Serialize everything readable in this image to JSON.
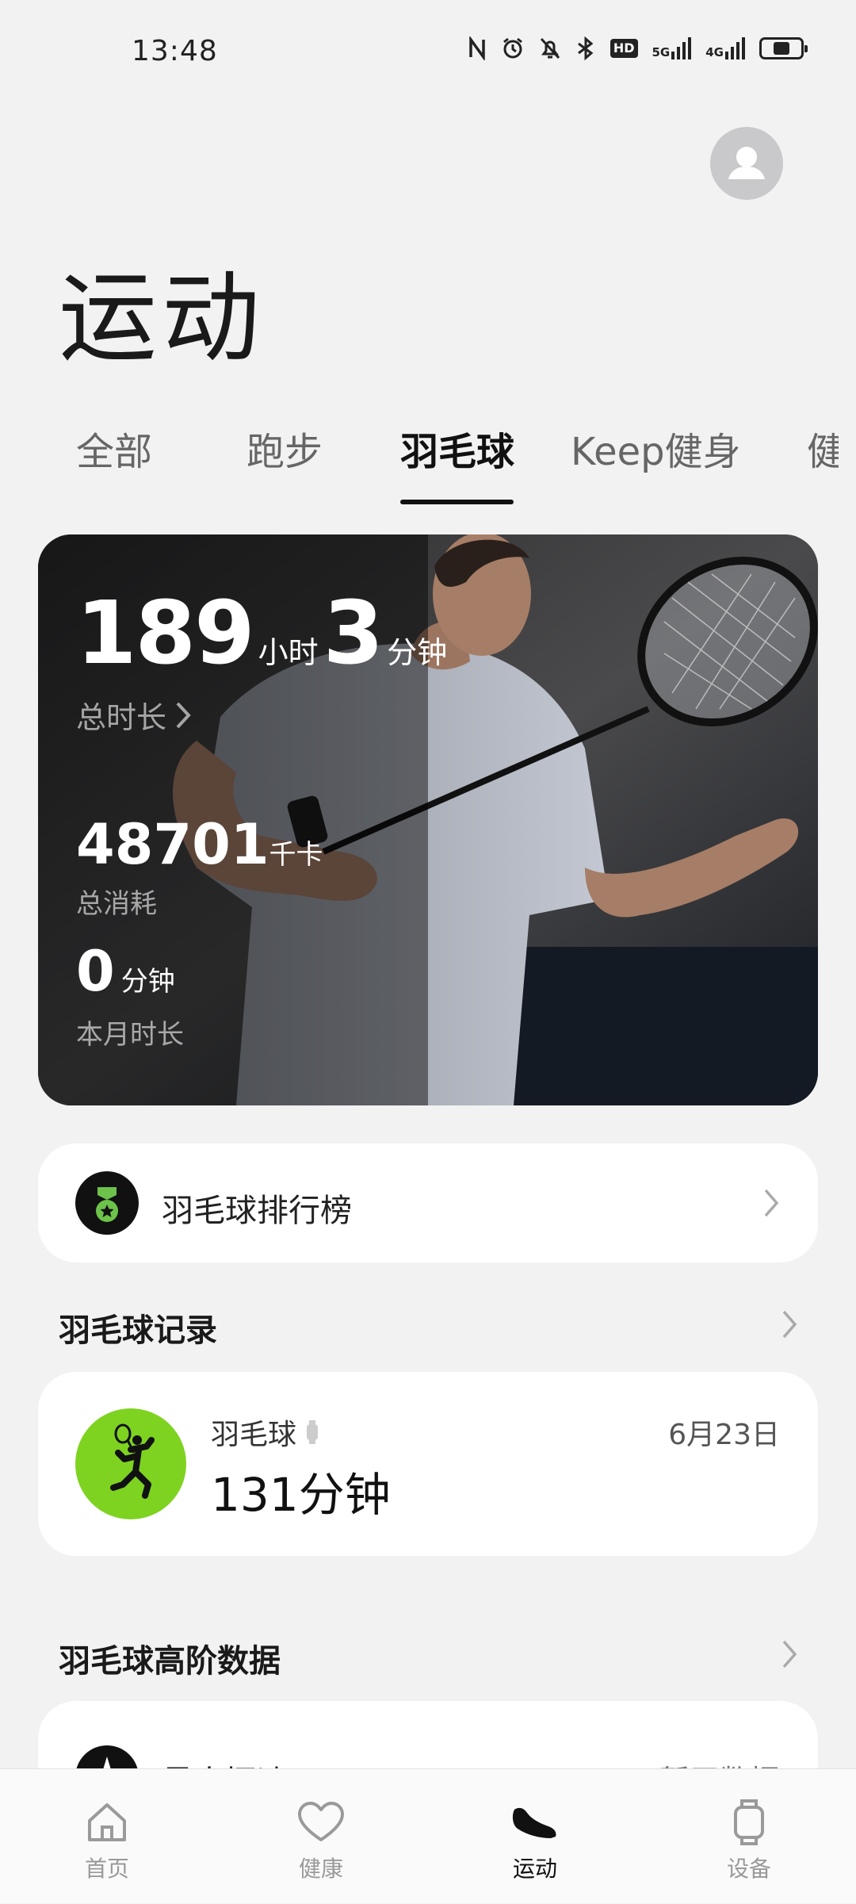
{
  "status_bar": {
    "time": "13:48",
    "hd_badge": "HD",
    "net1": "5G",
    "net2": "4G",
    "battery_level": 0.45
  },
  "header": {
    "title": "运动"
  },
  "tabs": [
    {
      "label": "全部"
    },
    {
      "label": "跑步"
    },
    {
      "label": "羽毛球"
    },
    {
      "label": "Keep健身"
    },
    {
      "label": "健"
    }
  ],
  "hero": {
    "total_hours": "189",
    "hours_unit": "小时",
    "total_minutes": "3",
    "minutes_unit": "分钟",
    "total_label": "总时长",
    "calories": "48701",
    "calories_unit": "千卡",
    "calories_label": "总消耗",
    "month_minutes": "0",
    "month_unit": "分钟",
    "month_label": "本月时长"
  },
  "leaderboard": {
    "label": "羽毛球排行榜"
  },
  "records": {
    "section_title": "羽毛球记录",
    "item": {
      "type": "羽毛球",
      "duration": "131分钟",
      "date": "6月23日"
    }
  },
  "advanced": {
    "section_title": "羽毛球高阶数据",
    "item_label": "最大挥速",
    "item_value": "暂无数据"
  },
  "bottom_nav": [
    {
      "label": "首页",
      "icon": "home-icon"
    },
    {
      "label": "健康",
      "icon": "heart-icon"
    },
    {
      "label": "运动",
      "icon": "shoe-icon"
    },
    {
      "label": "设备",
      "icon": "watch-icon"
    }
  ],
  "colors": {
    "accent_green": "#7ed321",
    "background": "#f2f2f3",
    "card": "#ffffff"
  }
}
